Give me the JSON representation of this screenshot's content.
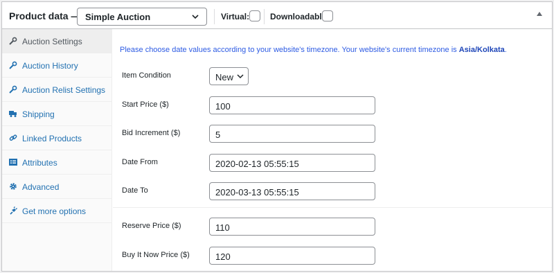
{
  "header": {
    "title": "Product data —",
    "product_type": "Simple Auction",
    "virtual_label": "Virtual:",
    "downloadable_label": "Downloadable:"
  },
  "sidebar": {
    "items": [
      {
        "label": "Auction Settings",
        "icon": "wrench-icon",
        "active": true
      },
      {
        "label": "Auction History",
        "icon": "wrench-icon"
      },
      {
        "label": "Auction Relist Settings",
        "icon": "wrench-icon"
      },
      {
        "label": "Shipping",
        "icon": "truck-icon"
      },
      {
        "label": "Linked Products",
        "icon": "link-icon"
      },
      {
        "label": "Attributes",
        "icon": "list-icon"
      },
      {
        "label": "Advanced",
        "icon": "gear-icon"
      },
      {
        "label": "Get more options",
        "icon": "plugin-icon"
      }
    ]
  },
  "notice": {
    "text": "Please choose date values according to your website's timezone. Your website's current timezone is ",
    "timezone": "Asia/Kolkata",
    "suffix": "."
  },
  "fields": {
    "item_condition": {
      "label": "Item Condition",
      "value": "New"
    },
    "start_price": {
      "label": "Start Price ($)",
      "value": "100"
    },
    "bid_increment": {
      "label": "Bid Increment ($)",
      "value": "5"
    },
    "date_from": {
      "label": "Date From",
      "value": "2020-02-13 05:55:15"
    },
    "date_to": {
      "label": "Date To",
      "value": "2020-03-13 05:55:15"
    },
    "reserve_price": {
      "label": "Reserve Price ($)",
      "value": "110"
    },
    "buy_it_now_price": {
      "label": "Buy It Now Price ($)",
      "value": "120"
    }
  },
  "colors": {
    "link": "#2271b1",
    "notice": "#2d5be3",
    "active_tab_bg": "#eeeeee"
  }
}
